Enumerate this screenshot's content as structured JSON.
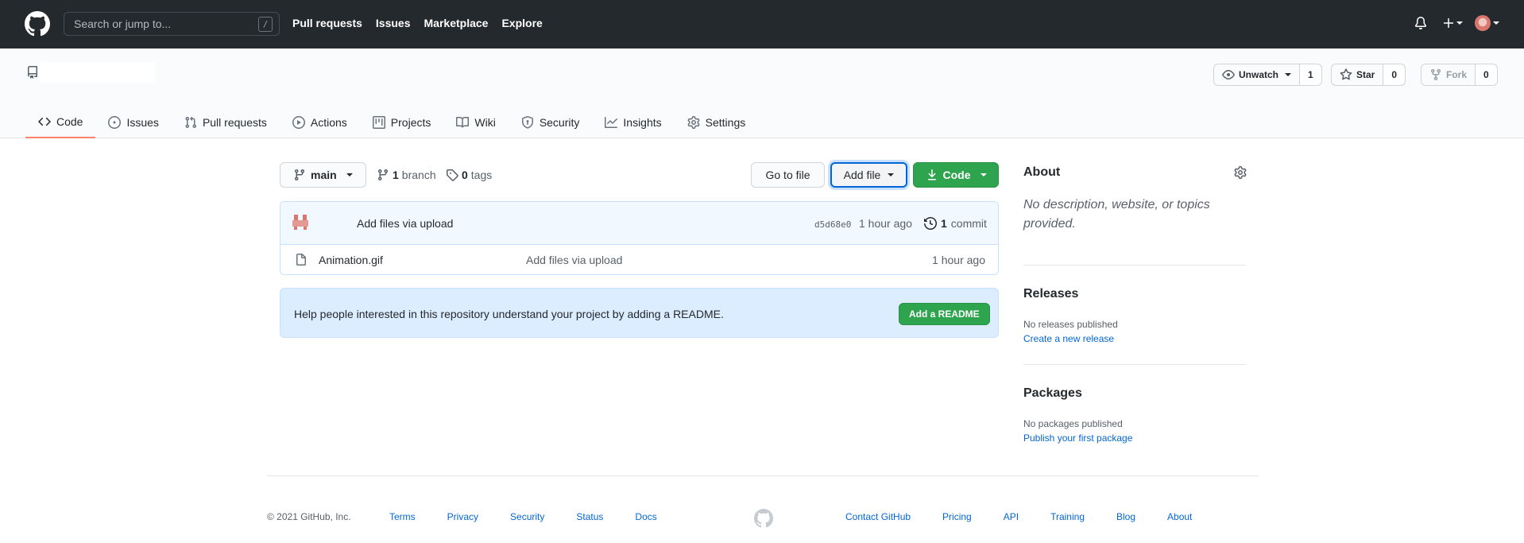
{
  "header": {
    "search_placeholder": "Search or jump to...",
    "search_shortcut": "/",
    "nav": [
      "Pull requests",
      "Issues",
      "Marketplace",
      "Explore"
    ]
  },
  "repo": {
    "watch_label": "Unwatch",
    "watch_count": "1",
    "star_label": "Star",
    "star_count": "0",
    "fork_label": "Fork",
    "fork_count": "0",
    "tabs": [
      {
        "label": "Code",
        "icon": "code-icon",
        "selected": true
      },
      {
        "label": "Issues",
        "icon": "issue-icon"
      },
      {
        "label": "Pull requests",
        "icon": "pull-request-icon"
      },
      {
        "label": "Actions",
        "icon": "play-icon"
      },
      {
        "label": "Projects",
        "icon": "project-icon"
      },
      {
        "label": "Wiki",
        "icon": "book-icon"
      },
      {
        "label": "Security",
        "icon": "shield-icon"
      },
      {
        "label": "Insights",
        "icon": "graph-icon"
      },
      {
        "label": "Settings",
        "icon": "gear-icon"
      }
    ]
  },
  "toolbar": {
    "branch": "main",
    "branch_count": "1",
    "branch_label": "branch",
    "tag_count": "0",
    "tag_label": "tags",
    "goto_file": "Go to file",
    "add_file": "Add file",
    "code": "Code"
  },
  "commit": {
    "message": "Add files via upload",
    "sha": "d5d68e0",
    "time": "1 hour ago",
    "count": "1",
    "count_label": "commit"
  },
  "files": [
    {
      "name": "Animation.gif",
      "message": "Add files via upload",
      "time": "1 hour ago"
    }
  ],
  "readme": {
    "text": "Help people interested in this repository understand your project by adding a README.",
    "button": "Add a README"
  },
  "sidebar": {
    "about_title": "About",
    "about_desc": "No description, website, or topics provided.",
    "releases_title": "Releases",
    "releases_none": "No releases published",
    "releases_link": "Create a new release",
    "packages_title": "Packages",
    "packages_none": "No packages published",
    "packages_link": "Publish your first package"
  },
  "footer": {
    "copyright": "© 2021 GitHub, Inc.",
    "left_links": [
      "Terms",
      "Privacy",
      "Security",
      "Status",
      "Docs"
    ],
    "right_links": [
      "Contact GitHub",
      "Pricing",
      "API",
      "Training",
      "Blog",
      "About"
    ]
  },
  "colors": {
    "header_bg": "#24292e",
    "accent_green": "#2ea44f",
    "link_blue": "#0366d6",
    "tab_underline": "#f9826c"
  }
}
